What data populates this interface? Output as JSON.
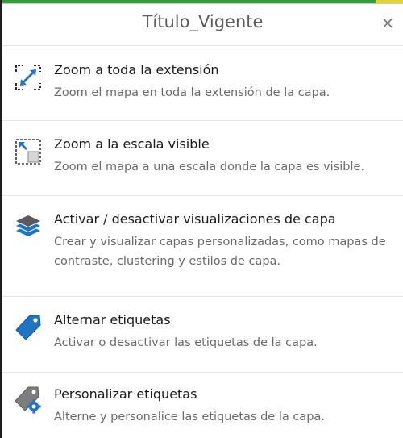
{
  "panel": {
    "title": "Título_Vigente",
    "close_symbol": "×"
  },
  "items": [
    {
      "icon": "zoom-extent-icon",
      "title": "Zoom a toda la extensión",
      "description": "Zoom el mapa en toda la extensión de la capa."
    },
    {
      "icon": "zoom-visible-scale-icon",
      "title": "Zoom a la escala visible",
      "description": "Zoom el mapa a una escala donde la capa es visible."
    },
    {
      "icon": "layers-icon",
      "title": "Activar / desactivar visualizaciones de capa",
      "description": "Crear y visualizar capas personalizadas, como mapas de contraste, clustering y estilos de capa."
    },
    {
      "icon": "tag-icon",
      "title": "Alternar etiquetas",
      "description": "Activar o desactivar las etiquetas de la capa."
    },
    {
      "icon": "tag-settings-icon",
      "title": "Personalizar etiquetas",
      "description": "Alterne y personalice las etiquetas de la capa."
    }
  ],
  "colors": {
    "icon_blue": "#1f74c4",
    "top_strip_green": "#2e9e3d",
    "top_strip_yellow": "#e2d52a"
  }
}
